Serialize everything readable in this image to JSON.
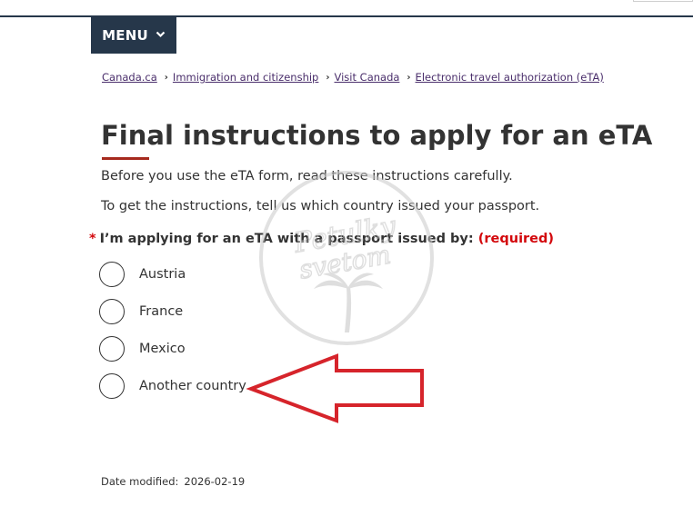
{
  "menu": {
    "label": "MENU"
  },
  "breadcrumb": [
    {
      "label": "Canada.ca"
    },
    {
      "label": "Immigration and citizenship"
    },
    {
      "label": "Visit Canada"
    },
    {
      "label": "Electronic travel authorization (eTA)"
    }
  ],
  "title": "Final instructions to apply for an eTA",
  "intro": [
    "Before you use the eTA form, read these instructions carefully.",
    "To get the instructions, tell us which country issued your passport."
  ],
  "question": {
    "asterisk": "*",
    "label": "I’m applying for an eTA with a passport issued by:",
    "required": "(required)",
    "options": [
      {
        "label": "Austria",
        "selected": false
      },
      {
        "label": "France",
        "selected": false
      },
      {
        "label": "Mexico",
        "selected": false
      },
      {
        "label": "Another country",
        "selected": false
      }
    ]
  },
  "watermark": {
    "line1": "Petulky",
    "line2": "svetom"
  },
  "date_modified": {
    "label": "Date modified:",
    "value": "2026-02-19"
  },
  "colors": {
    "menu_bg": "#26374a",
    "link": "#4a2e6b",
    "title_underline": "#a62a1e",
    "required": "#d3080c",
    "arrow": "#d6242b"
  }
}
